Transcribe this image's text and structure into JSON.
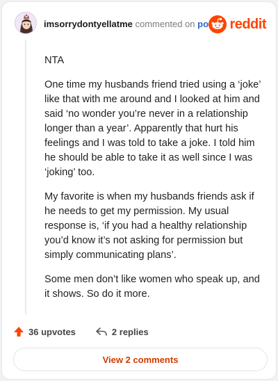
{
  "header": {
    "username": "imsorrydontyellatme",
    "action": "commented on",
    "post_link": "post",
    "brand": "reddit"
  },
  "comment": {
    "paragraphs": [
      "NTA",
      "One time my husbands friend tried using a ‘joke’ like that with me around and I looked at him and said ‘no wonder you’re never in a relationship longer than a year’. Apparently that hurt his feelings and I was told to take a joke. I told him he should be able to take it as well since I was ‘joking’ too.",
      "My favorite is when my husbands friends ask if he needs to get my permission. My usual response is, ‘if you had a healthy relationship you’d know it’s not asking for permission but simply communicating plans’.",
      "Some men don’t like women who speak up, and it shows. So do it more."
    ]
  },
  "footer": {
    "upvotes": "36 upvotes",
    "replies": "2 replies",
    "view_comments": "View 2 comments"
  },
  "colors": {
    "brand": "#ff4500",
    "link": "#2c67c8",
    "button_text": "#d13a00"
  },
  "icons": [
    "avatar-icon",
    "reddit-logo-icon",
    "upvote-arrow-icon",
    "reply-arrow-icon"
  ]
}
